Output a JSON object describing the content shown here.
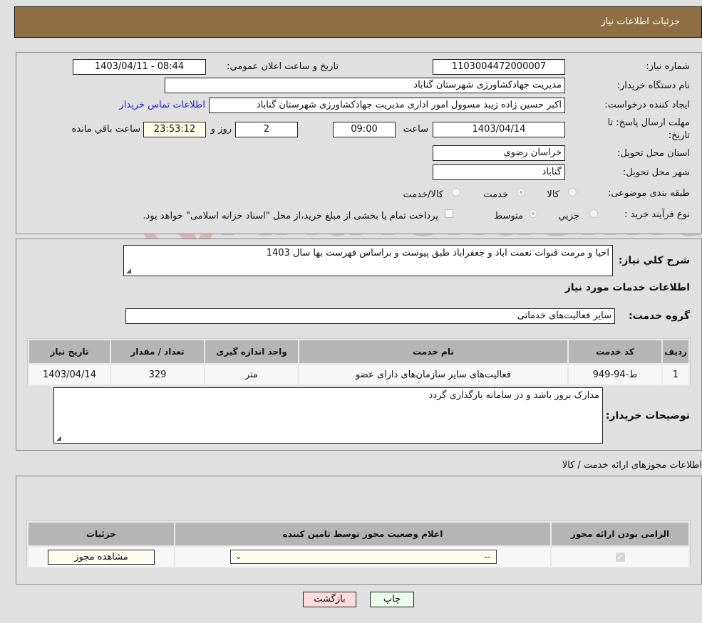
{
  "header": {
    "title": "جزئيات اطلاعات نياز"
  },
  "form": {
    "need_number_label": "شماره نیاز:",
    "need_number": "1103004472000007",
    "announce_label": "تاريخ و ساعت اعلان عمومي:",
    "announce_value": "1403/04/11 - 08:44",
    "buyer_org_label": "نام دستگاه خریدار:",
    "buyer_org": "مدیریت جهادکشاورزی شهرستان گناباد",
    "creator_label": "ایجاد کننده درخواست:",
    "creator": "اکبر حسین زاده زیبد مسوول امور اداری مدیریت جهادکشاورزی شهرستان گناباد",
    "contact_link": "اطلاعات تماس خریدار",
    "deadline_label_line1": "مهلت ارسال پاسخ: تا",
    "deadline_label_line2": "تاریخ:",
    "deadline_date": "1403/04/14",
    "hour_label": "ساعت",
    "deadline_time": "09:00",
    "days_value": "2",
    "days_label": "روز و",
    "remaining_time": "23:53:12",
    "remaining_label": "ساعت باقي مانده",
    "province_label": "استان محل تحویل:",
    "province": "خراسان رضوی",
    "city_label": "شهر محل تحویل:",
    "city": "گناباد",
    "category_label": "طبقه بندی موضوعی:",
    "category_options": [
      {
        "label": "کالا",
        "checked": false
      },
      {
        "label": "خدمت",
        "checked": true
      },
      {
        "label": "کالا/خدمت",
        "checked": false
      }
    ],
    "process_label": "نوع فرآیند خرید :",
    "process_options": [
      {
        "label": "جزيي",
        "checked": false
      },
      {
        "label": "متوسط",
        "checked": true
      }
    ],
    "payment_note": "پرداخت تمام یا بخشی از مبلغ خرید،از محل \"اسناد خزانه اسلامی\" خواهد بود."
  },
  "details": {
    "description_label": "شرح كلي نياز:",
    "description": "احیا و مرمت قنوات نعمت اباد و جعفراباد طبق پیوست و براساس فهرست بها سال 1403",
    "services_title": "اطلاعات خدمات مورد نیاز",
    "service_group_label": "گروه خدمت:",
    "service_group": "سایر فعالیت‌های خدماتی",
    "table": {
      "headers": [
        "ردیف",
        "کد خدمت",
        "نام خدمت",
        "واحد اندازه گیری",
        "تعداد / مقدار",
        "تاریخ نیاز"
      ],
      "rows": [
        [
          "1",
          "ط-94-949",
          "فعالیت‌های سایر سازمان‌های دارای عضو",
          "متر",
          "329",
          "1403/04/14"
        ]
      ]
    },
    "buyer_notes_label": "توضیحات خریدار:",
    "buyer_notes": "مدارک بروز باشد و در سامانه بارگذاری گردد"
  },
  "permits": {
    "section_title": "اطلاعات مجوزهای ارائه خدمت / کالا",
    "headers": [
      "الزامی بودن ارائه مجوز",
      "اعلام وضعیت مجوز توسط تامین کننده",
      "جزئیات"
    ],
    "row": {
      "required_checked": true,
      "status_value": "--",
      "view_button": "مشاهده مجوز"
    }
  },
  "actions": {
    "print": "چاپ",
    "back": "بازگشت"
  },
  "watermark": {
    "text": "AriaTender.neT"
  }
}
